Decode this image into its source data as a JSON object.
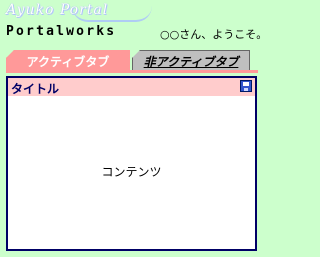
{
  "header": {
    "logo_script": "Ayuko Portal",
    "brand": "Portalworks",
    "welcome": "○○さん、ようこそ。"
  },
  "tabs": [
    {
      "label": "アクティブタブ",
      "state": "active"
    },
    {
      "label": "非アクティブタブ",
      "state": "inactive"
    }
  ],
  "portlet": {
    "title": "タイトル",
    "save_icon": "floppy-disk-icon",
    "content": "コンテンツ"
  },
  "colors": {
    "background": "#ccffcc",
    "active_tab": "#ff9999",
    "inactive_tab": "#bfbfbf",
    "portlet_header": "#ffcccc",
    "portlet_border": "#000066"
  }
}
